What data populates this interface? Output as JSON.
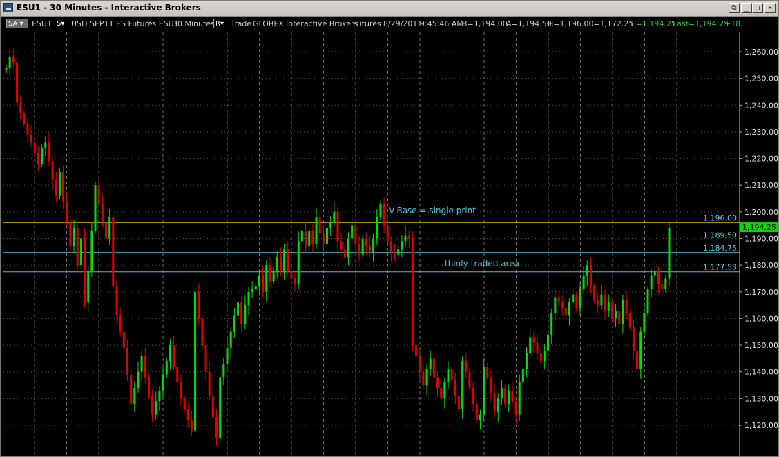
{
  "window": {
    "title": "ESU1 - 30 Minutes - Interactive Brokers",
    "buttons": [
      "⧉",
      "_",
      "□",
      "✕"
    ]
  },
  "infobar": {
    "sa_combo": "SA",
    "symbol": "ESU1",
    "s_combo": "S",
    "description": "USD SEP11 ES Futures ESU1",
    "interval": "30 Minutes",
    "r_combo": "R",
    "type": "Trade",
    "exchange": "GLOBEX",
    "broker": "Interactive Brokers",
    "sec_type": "Futures",
    "date": "8/29/2011",
    "time": "9:45:46 AM",
    "bid": "B=1,194.00",
    "ask": "A=1,194.50",
    "high": "H=1,196.00",
    "low": "L=1,172.25",
    "close": "C=1,194.25",
    "last": "Last=1,194.25",
    "change": "+18."
  },
  "colors": {
    "up": "#00e000",
    "down": "#e00000",
    "grid": "#707070",
    "level_orange": "#c8a000",
    "level_blue": "#2020ff",
    "level_cyan": "#40c8d8",
    "annotation": "#4ac6d6",
    "last_price_bg": "#00dc00"
  },
  "chart_data": {
    "type": "candlestick",
    "ylim": [
      1116,
      1266
    ],
    "ytick_labels": [
      "1,260.00",
      "1,250.00",
      "1,240.00",
      "1,230.00",
      "1,220.00",
      "1,210.00",
      "1,200.00",
      "1,190.00",
      "1,180.00",
      "1,170.00",
      "1,160.00",
      "1,150.00",
      "1,140.00",
      "1,130.00",
      "1,120.00"
    ],
    "ytick_values": [
      1260,
      1250,
      1240,
      1230,
      1220,
      1210,
      1200,
      1190,
      1180,
      1170,
      1160,
      1150,
      1140,
      1130,
      1120
    ],
    "last_price": {
      "value": 1194.25,
      "label": "1,194.25"
    },
    "levels": [
      {
        "value": 1196.0,
        "label": "1,196.00",
        "color": "#c8a000"
      },
      {
        "value": 1189.5,
        "label": "1,189.50",
        "color": "#2020ff"
      },
      {
        "value": 1184.75,
        "label": "1,184.75",
        "color": "#40c8d8"
      },
      {
        "value": 1177.53,
        "label": "1,177.53",
        "color": "#40c8d8"
      }
    ],
    "annotations": [
      {
        "text": "V-Base = single print",
        "price": 1199.5
      },
      {
        "text": "thinly-traded area",
        "price": 1179.5
      }
    ],
    "closes": [
      1254,
      1258,
      1256,
      1241,
      1237,
      1233,
      1229,
      1226,
      1222,
      1218,
      1224,
      1226,
      1219,
      1212,
      1206,
      1215,
      1204,
      1196,
      1187,
      1194,
      1180,
      1190,
      1166,
      1178,
      1193,
      1210,
      1203,
      1196,
      1190,
      1198,
      1172,
      1161,
      1155,
      1149,
      1139,
      1128,
      1134,
      1140,
      1146,
      1138,
      1131,
      1124,
      1129,
      1133,
      1139,
      1144,
      1150,
      1142,
      1136,
      1130,
      1126,
      1122,
      1118,
      1170,
      1160,
      1150,
      1140,
      1131,
      1123,
      1115,
      1138,
      1143,
      1149,
      1155,
      1161,
      1166,
      1158,
      1165,
      1170,
      1171,
      1172,
      1176,
      1170,
      1180,
      1174,
      1178,
      1183,
      1178,
      1186,
      1178,
      1175,
      1173,
      1189,
      1193,
      1187,
      1193,
      1188,
      1198,
      1192,
      1188,
      1194,
      1196,
      1200,
      1189,
      1186,
      1183,
      1190,
      1195,
      1188,
      1184,
      1190,
      1187,
      1185,
      1190,
      1198,
      1203,
      1195,
      1189,
      1185,
      1184,
      1186,
      1189,
      1191,
      1190,
      1150,
      1146,
      1140,
      1135,
      1141,
      1145,
      1138,
      1134,
      1130,
      1136,
      1141,
      1137,
      1131,
      1126,
      1144,
      1140,
      1134,
      1128,
      1122,
      1124,
      1142,
      1138,
      1132,
      1125,
      1130,
      1134,
      1128,
      1133,
      1129,
      1124,
      1136,
      1141,
      1147,
      1153,
      1151,
      1147,
      1144,
      1148,
      1154,
      1162,
      1168,
      1166,
      1164,
      1161,
      1166,
      1169,
      1164,
      1171,
      1176,
      1180,
      1172,
      1167,
      1165,
      1169,
      1163,
      1166,
      1160,
      1163,
      1158,
      1167,
      1162,
      1157,
      1148,
      1141,
      1155,
      1162,
      1171,
      1176,
      1178,
      1173,
      1171,
      1175,
      1194
    ]
  }
}
